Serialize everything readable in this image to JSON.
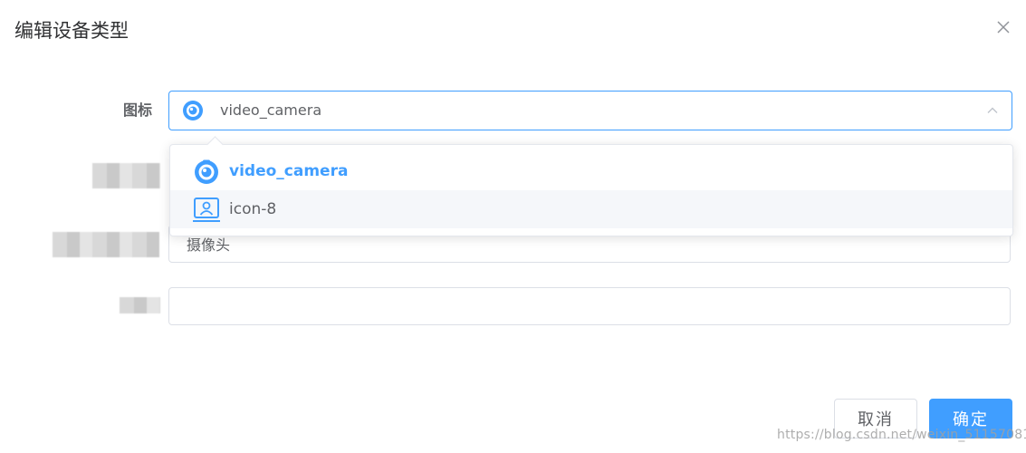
{
  "dialog": {
    "title": "编辑设备类型",
    "close_icon": "close-icon"
  },
  "form": {
    "icon_label": "图标",
    "icon_select": {
      "value": "video_camera",
      "value_icon": "video-camera-icon",
      "arrow_icon": "chevron-up-icon",
      "options": [
        {
          "label": "video_camera",
          "icon": "video-camera-icon",
          "state": "selected"
        },
        {
          "label": "icon-8",
          "icon": "user-badge-icon",
          "state": "hovered"
        }
      ]
    },
    "name_value": "摄像头",
    "last_value": ""
  },
  "footer": {
    "cancel_label": "取消",
    "confirm_label": "确定"
  },
  "watermark": "https://blog.csdn.net/weixin_51157081",
  "colors": {
    "primary": "#409eff",
    "border": "#dcdfe6",
    "text": "#606266",
    "title": "#303133"
  }
}
